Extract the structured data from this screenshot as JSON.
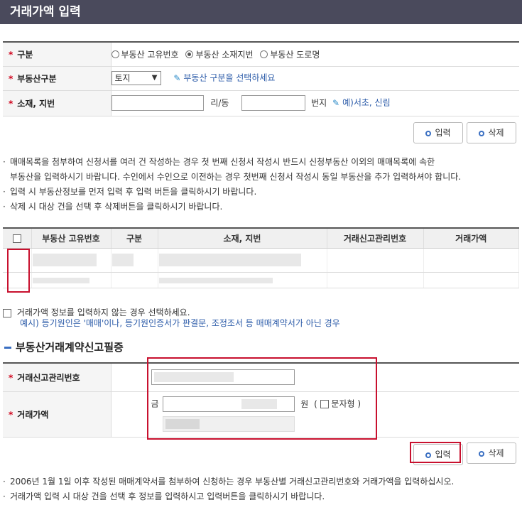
{
  "title": "거래가액 입력",
  "form": {
    "category": {
      "label": "구분",
      "options": [
        "부동산 고유번호",
        "부동산 소재지번",
        "부동산 도로명"
      ],
      "selected": "부동산 소재지번"
    },
    "property_type": {
      "label": "부동산구분",
      "value": "토지",
      "hint": "부동산 구분을 선택하세요"
    },
    "address": {
      "label": "소재, 지번",
      "ri_dong": "리/동",
      "beonji": "번지",
      "example": "예)서초, 신림"
    }
  },
  "buttons": {
    "input": "입력",
    "delete": "삭제"
  },
  "notes_top": [
    "매매목록을 첨부하여 신청서를 여러 건 작성하는 경우 첫 번째 신청서 작성시 반드시 신청부동산 이외의 매매목록에 속한",
    "부동산을 입력하시기 바랍니다. 수인에서 수인으로 이전하는 경우 첫번째 신청서 작성시 동일 부동산을 추가 입력하셔야 합니다.",
    "입력 시 부동산정보를 먼저 입력 후 입력 버튼을 클릭하시기 바랍니다.",
    "삭제 시 대상 건을 선택 후 삭제버튼을 클릭하시기 바랍니다."
  ],
  "table": {
    "headers": [
      "부동산 고유번호",
      "구분",
      "소재, 지번",
      "거래신고관리번호",
      "거래가액"
    ]
  },
  "no_price": {
    "label": "거래가액 정보를 입력하지 않는 경우 선택하세요.",
    "example": "예시) 등기원인은 '매매'이나, 등기원인증서가 판결문, 조정조서 등 매매계약서가 아닌 경우"
  },
  "section": {
    "title": "부동산거래계약신고필증",
    "report_no_label": "거래신고관리번호",
    "price_label": "거래가액",
    "geum": "금",
    "won": "원",
    "text_type": "문자형"
  },
  "notes_bottom": [
    "2006년 1월 1일 이후 작성된 매매계약서를 첨부하여 신청하는 경우 부동산별 거래신고관리번호와 거래가액을 입력하십시오.",
    "거래가액 입력 시 대상 건을 선택 후 정보를 입력하시고 입력버튼을 클릭하시기 바랍니다."
  ]
}
